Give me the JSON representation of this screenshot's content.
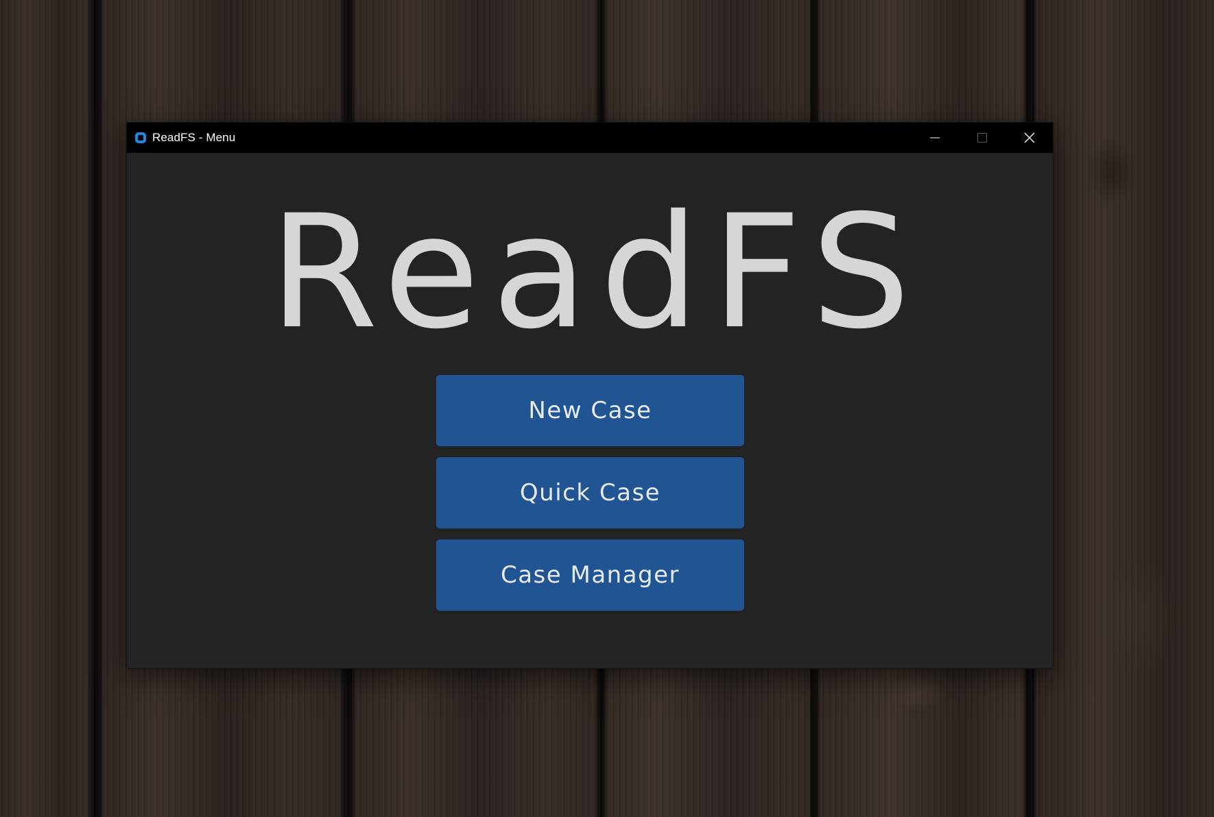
{
  "window": {
    "title": "ReadFS - Menu",
    "icon": "app-icon",
    "controls": {
      "minimize_icon": "minimize-icon",
      "maximize_icon": "maximize-icon",
      "close_icon": "close-icon"
    }
  },
  "main": {
    "logo_text": "ReadFS",
    "buttons": [
      {
        "label": "New Case"
      },
      {
        "label": "Quick Case"
      },
      {
        "label": "Case Manager"
      }
    ]
  },
  "colors": {
    "button_bg": "#215493",
    "window_bg": "#232323",
    "titlebar_bg": "#000000",
    "logo_text": "#d6d6d6",
    "app_icon": "#1e88e5"
  }
}
